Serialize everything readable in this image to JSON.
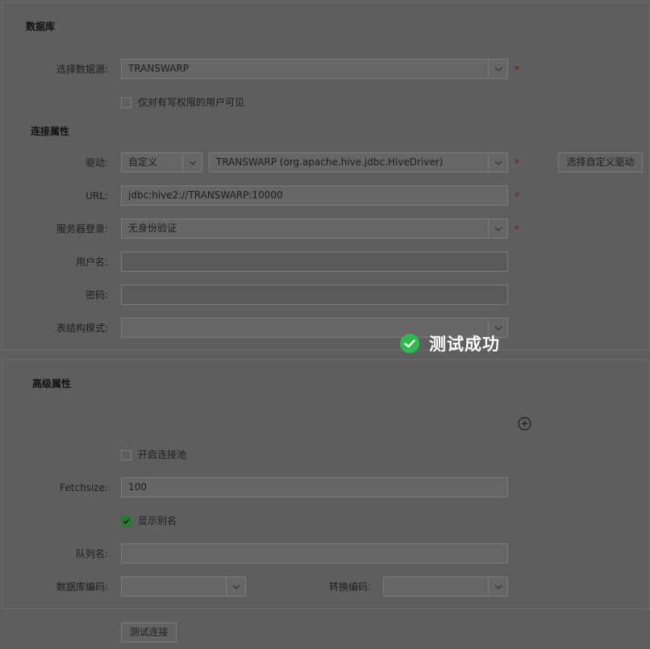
{
  "database": {
    "title": "数据库",
    "datasource_label": "选择数据源:",
    "datasource_value": "TRANSWARP",
    "write_only_label": "仅对有写权限的用户可见"
  },
  "connection": {
    "title": "连接属性",
    "driver_label": "驱动:",
    "driver_type": "自定义",
    "driver_value": "TRANSWARP (org.apache.hive.jdbc.HiveDriver)",
    "choose_driver_button": "选择自定义驱动",
    "url_label": "URL:",
    "url_value": "jdbc:hive2://TRANSWARP:10000",
    "login_label": "服务器登录:",
    "login_value": "无身份验证",
    "username_label": "用户名:",
    "password_label": "密码:",
    "schema_label": "表结构模式:"
  },
  "advanced": {
    "title": "高级属性",
    "pool_label": "开启连接池",
    "fetchsize_label": "Fetchsize:",
    "fetchsize_value": "100",
    "alias_label": "显示别名",
    "queue_label": "队列名:",
    "db_encoding_label": "数据库编码:",
    "convert_encoding_label": "转换编码:"
  },
  "required_mark": "*",
  "test_button": "测试连接",
  "toast": {
    "message": "测试成功"
  },
  "colors": {
    "success": "#2dbb4e",
    "required": "#7a1212",
    "check": "#2a7a36"
  }
}
